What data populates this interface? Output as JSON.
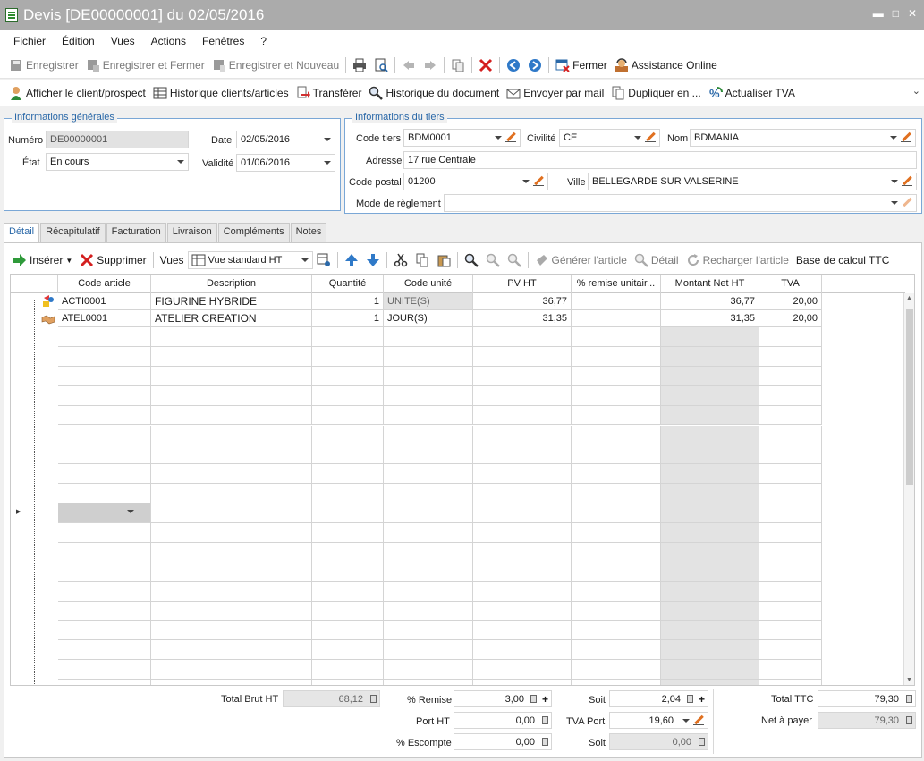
{
  "window": {
    "title": "Devis [DE00000001] du 02/05/2016"
  },
  "menu": [
    "Fichier",
    "Édition",
    "Vues",
    "Actions",
    "Fenêtres",
    "?"
  ],
  "toolbar1": {
    "save": "Enregistrer",
    "save_close": "Enregistrer et Fermer",
    "save_new": "Enregistrer et Nouveau",
    "close": "Fermer",
    "assist": "Assistance Online"
  },
  "toolbar2": {
    "show_client": "Afficher le client/prospect",
    "history_clients": "Historique clients/articles",
    "transfer": "Transférer",
    "history_doc": "Historique du document",
    "send_mail": "Envoyer par mail",
    "duplicate": "Dupliquer en ...",
    "update_vat": "Actualiser TVA"
  },
  "general": {
    "legend": "Informations générales",
    "numero_label": "Numéro",
    "numero": "DE00000001",
    "date_label": "Date",
    "date": "02/05/2016",
    "etat_label": "État",
    "etat": "En cours",
    "validite_label": "Validité",
    "validite": "01/06/2016"
  },
  "tiers": {
    "legend": "Informations du tiers",
    "code_label": "Code tiers",
    "code": "BDM0001",
    "civilite_label": "Civilité",
    "civilite": "CE",
    "nom_label": "Nom",
    "nom": "BDMANIA",
    "adresse_label": "Adresse",
    "adresse": "17 rue Centrale",
    "cp_label": "Code postal",
    "cp": "01200",
    "ville_label": "Ville",
    "ville": "BELLEGARDE SUR VALSERINE",
    "reglement_label": "Mode de règlement",
    "reglement": ""
  },
  "tabs": [
    "Détail",
    "Récapitulatif",
    "Facturation",
    "Livraison",
    "Compléments",
    "Notes"
  ],
  "gridtb": {
    "insert": "Insérer",
    "delete": "Supprimer",
    "views_label": "Vues",
    "view": "Vue standard HT",
    "generate": "Générer l'article",
    "detail": "Détail",
    "reload": "Recharger l'article",
    "base": "Base de calcul TTC"
  },
  "columns": [
    "Code article",
    "Description",
    "Quantité",
    "Code unité",
    "PV HT",
    "% remise unitair...",
    "Montant Net HT",
    "TVA"
  ],
  "rows": [
    {
      "code": "ACTI0001",
      "desc": "FIGURINE HYBRIDE",
      "qty": "1",
      "unit": "UNITE(S)",
      "pv": "36,77",
      "remise": "",
      "net": "36,77",
      "tva": "20,00"
    },
    {
      "code": "ATEL0001",
      "desc": "ATELIER CREATION",
      "qty": "1",
      "unit": "JOUR(S)",
      "pv": "31,35",
      "remise": "",
      "net": "31,35",
      "tva": "20,00"
    }
  ],
  "totals": {
    "brut_label": "Total Brut HT",
    "brut": "68,12",
    "remise_label": "% Remise",
    "remise": "3,00",
    "soit1_label": "Soit",
    "soit1": "2,04",
    "port_label": "Port HT",
    "port": "0,00",
    "tvaport_label": "TVA Port",
    "tvaport": "19,60",
    "escompte_label": "% Escompte",
    "escompte": "0,00",
    "soit2_label": "Soit",
    "soit2": "0,00",
    "ttc_label": "Total TTC",
    "ttc": "79,30",
    "net_label": "Net à payer",
    "net": "79,30"
  },
  "colors": {
    "title_bg": "#ababab",
    "accent": "#2a68a8",
    "group_border": "#7aa7d6"
  }
}
